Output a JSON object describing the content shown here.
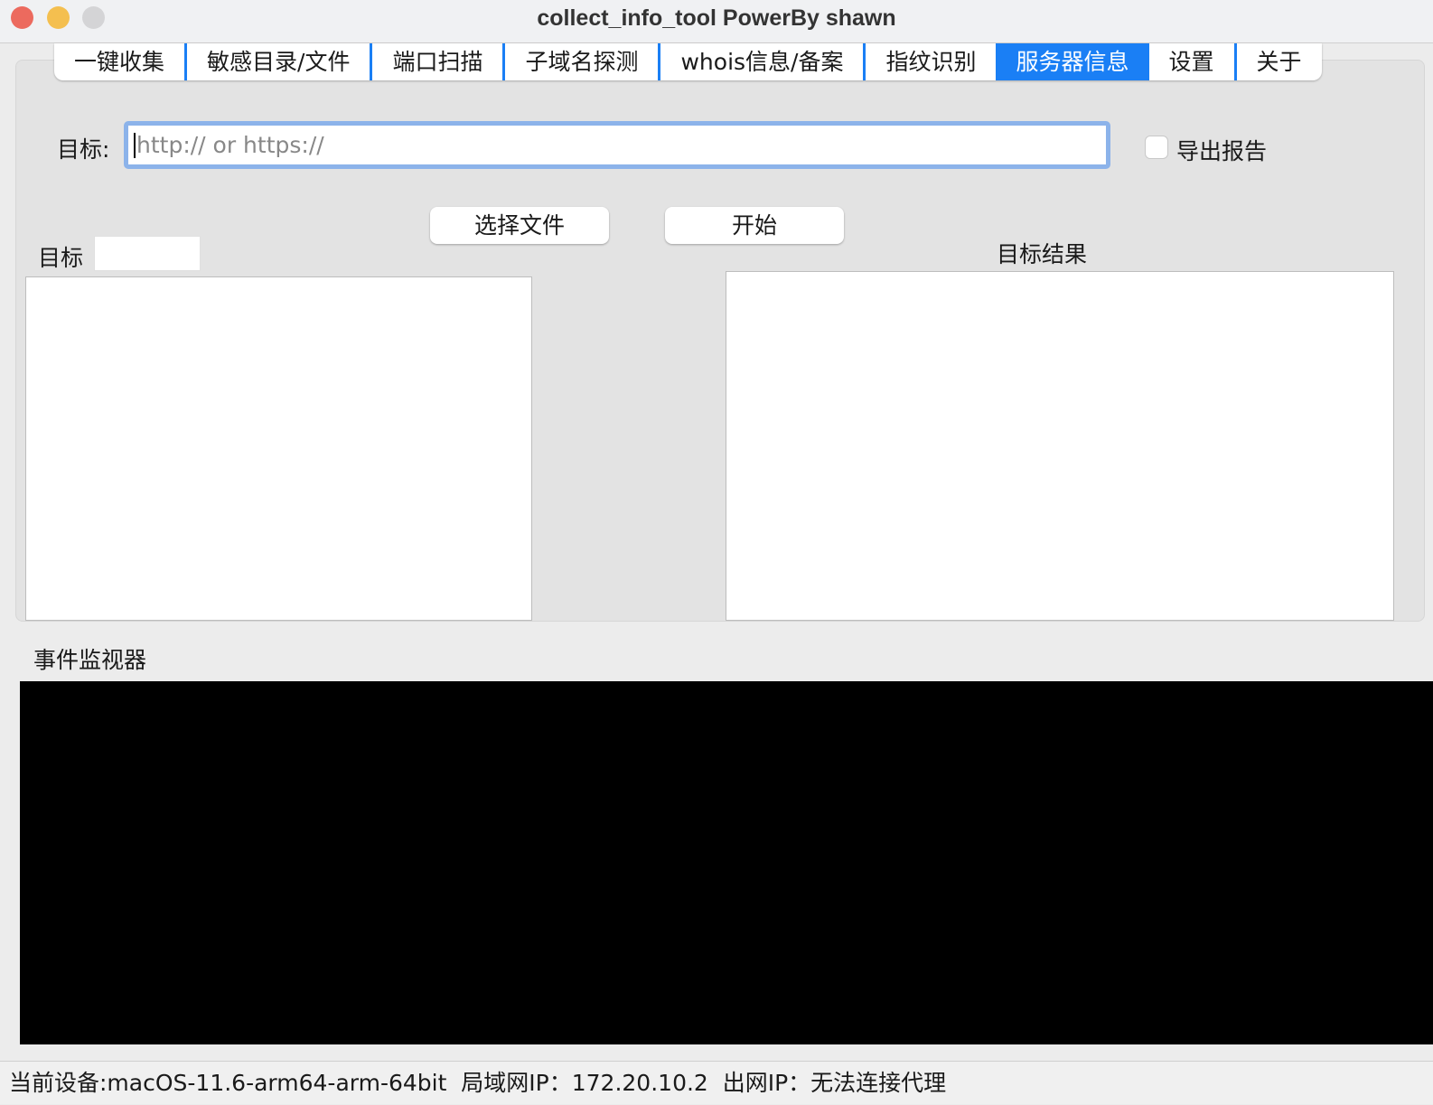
{
  "window": {
    "title": "collect_info_tool   PowerBy shawn"
  },
  "tabs": [
    {
      "label": "一键收集"
    },
    {
      "label": "敏感目录/文件"
    },
    {
      "label": "端口扫描"
    },
    {
      "label": "子域名探测"
    },
    {
      "label": "whois信息/备案"
    },
    {
      "label": "指纹识别"
    },
    {
      "label": "服务器信息",
      "active": true
    },
    {
      "label": "设置"
    },
    {
      "label": "关于"
    }
  ],
  "form": {
    "target_label": "目标:",
    "target_input": {
      "value": "",
      "placeholder": "http:// or https://"
    },
    "export_label": "导出报告",
    "export_checked": false,
    "choose_file_label": "选择文件",
    "start_label": "开始",
    "targets_label": "目标",
    "targets_count": "",
    "results_label": "目标结果"
  },
  "monitor": {
    "label": "事件监视器"
  },
  "status": {
    "text": "当前设备:macOS-11.6-arm64-arm-64bit  局域网IP：172.20.10.2  出网IP：无法连接代理"
  },
  "colors": {
    "accent": "#1a7ff5",
    "monitor_bg": "#000000"
  }
}
